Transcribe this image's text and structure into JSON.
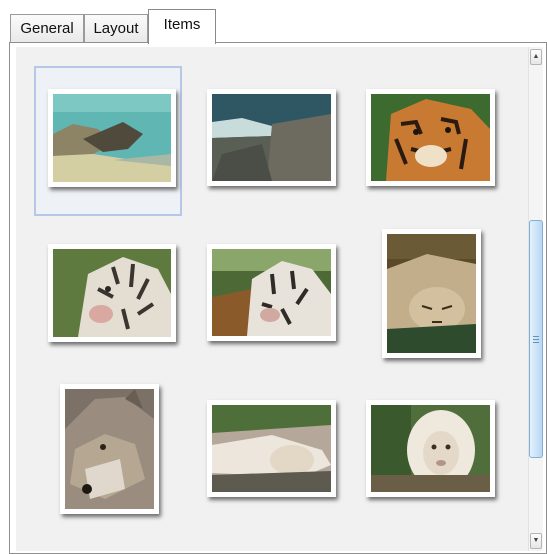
{
  "tabs": [
    {
      "label": "General",
      "active": false
    },
    {
      "label": "Layout",
      "active": false
    },
    {
      "label": "Items",
      "active": true
    }
  ],
  "items_view": {
    "selected_index": 0,
    "thumbnails": [
      {
        "subject": "coastline-cliff"
      },
      {
        "subject": "rocky-shore-waves"
      },
      {
        "subject": "tiger-in-grass"
      },
      {
        "subject": "white-tiger-face"
      },
      {
        "subject": "white-tiger-resting"
      },
      {
        "subject": "lioness-lying"
      },
      {
        "subject": "wolf-portrait"
      },
      {
        "subject": "white-lion-lying"
      },
      {
        "subject": "white-lion-standing"
      }
    ]
  },
  "scrollbar": {
    "up_icon": "arrow-up-icon",
    "down_icon": "arrow-down-icon",
    "position": 0.5
  }
}
